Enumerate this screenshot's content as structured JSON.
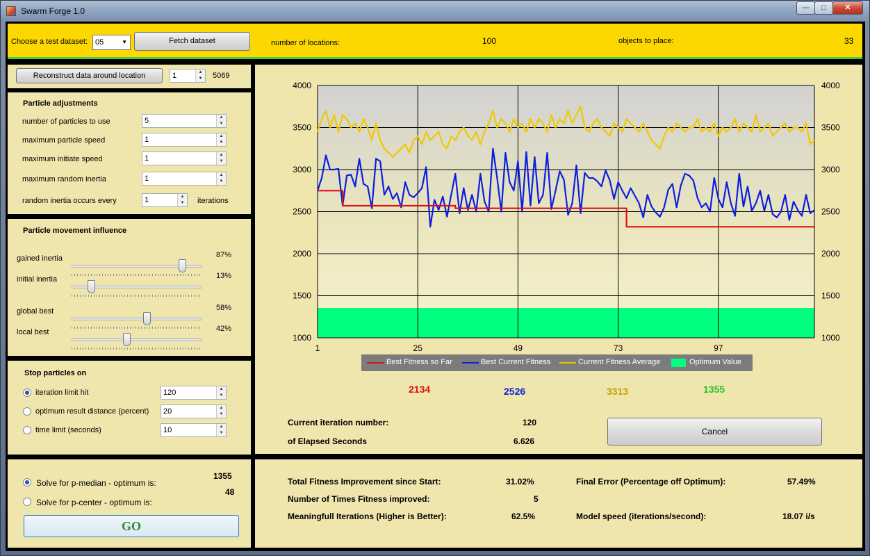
{
  "window": {
    "title": "Swarm Forge 1.0",
    "min": "—",
    "max": "□",
    "close": "✕"
  },
  "top": {
    "dataset_label": "Choose a test dataset:",
    "dataset_value": "05",
    "fetch_label": "Fetch dataset",
    "locations_label": "number of locations:",
    "locations_value": "100",
    "objects_label": "objects to place:",
    "objects_value": "33"
  },
  "reconstruct": {
    "button": "Reconstruct data around location",
    "location_value": "1",
    "count": "5069"
  },
  "particles": {
    "title": "Particle adjustments",
    "fields": [
      {
        "label": "number of particles to use",
        "value": "5"
      },
      {
        "label": "maximum particle speed",
        "value": "1"
      },
      {
        "label": "maximum initiate speed",
        "value": "1"
      },
      {
        "label": "maximum random inertia",
        "value": "1"
      }
    ],
    "random_label": "random inertia occurs every",
    "random_value": "1",
    "random_suffix": "iterations"
  },
  "movement": {
    "title": "Particle movement influence",
    "sliders": [
      {
        "label": "gained inertia",
        "percent": "87%",
        "level": 0.87
      },
      {
        "label": "initial inertia",
        "percent": "13%",
        "level": 0.13
      },
      {
        "label": "global best",
        "percent": "58%",
        "level": 0.58
      },
      {
        "label": "local best",
        "percent": "42%",
        "level": 0.42
      }
    ]
  },
  "stop": {
    "title": "Stop particles on",
    "options": [
      {
        "label": "iteration limit hit",
        "value": "120",
        "selected": true
      },
      {
        "label": "optimum result distance (percent)",
        "value": "20",
        "selected": false
      },
      {
        "label": "time limit (seconds)",
        "value": "10",
        "selected": false
      }
    ]
  },
  "solve": {
    "pmedian_label": "Solve for p-median - optimum is:",
    "pmedian_value": "1355",
    "pcenter_label": "Solve for p-center - optimum is:",
    "pcenter_value": "48",
    "go_label": "GO"
  },
  "legend": {
    "best_so_far": "Best Fitness so Far",
    "best_current": "Best Current Fitness",
    "average": "Current Fitness Average",
    "optimum": "Optimum Value"
  },
  "current": {
    "best_so_far": "2134",
    "best_current": "2526",
    "average": "3313",
    "optimum": "1355"
  },
  "colors": {
    "best_so_far": "#e01010",
    "best_current": "#0a1ee0",
    "average": "#f0c800",
    "optimum": "#00ff7f"
  },
  "progress": {
    "iteration_label": "Current iteration number:",
    "iteration_value": "120",
    "elapsed_label": "of Elapsed Seconds",
    "elapsed_value": "6.626",
    "cancel_label": "Cancel"
  },
  "summary": {
    "improvement_label": "Total Fitness Improvement since Start:",
    "improvement_value": "31.02%",
    "times_label": "Number of Times Fitness improved:",
    "times_value": "5",
    "meaningful_label": "Meaningfull Iterations (Higher is Better):",
    "meaningful_value": "62.5%",
    "error_label": "Final Error (Percentage off Optimum):",
    "error_value": "57.49%",
    "speed_label": "Model speed (iterations/second):",
    "speed_value": "18.07 i/s"
  },
  "chart_data": {
    "type": "line",
    "x_ticks": [
      "1",
      "25",
      "49",
      "73",
      "97"
    ],
    "y_ticks": [
      "1000",
      "1500",
      "2000",
      "2500",
      "3000",
      "3500",
      "4000"
    ],
    "xlim": [
      1,
      120
    ],
    "ylim": [
      1000,
      4000
    ],
    "grid": true,
    "legend_position": "bottom",
    "optimum": 1355,
    "series": [
      {
        "name": "Best Fitness so Far",
        "color": "#e01010",
        "x": [
          1,
          7,
          7,
          34,
          34,
          75,
          75,
          120
        ],
        "values": [
          2750,
          2750,
          2570,
          2570,
          2540,
          2540,
          2320,
          2320
        ]
      },
      {
        "name": "Best Current Fitness",
        "color": "#0a1ee0",
        "values": [
          2750,
          2900,
          3170,
          3000,
          3000,
          3010,
          2570,
          2930,
          2940,
          2800,
          3130,
          2830,
          2800,
          2540,
          3130,
          3100,
          2700,
          2800,
          2650,
          2720,
          2550,
          2850,
          2700,
          2670,
          2720,
          2780,
          3030,
          2320,
          2640,
          2520,
          2680,
          2440,
          2700,
          2950,
          2480,
          2780,
          2520,
          2700,
          2500,
          2950,
          2620,
          2500,
          3250,
          2900,
          2500,
          3200,
          2850,
          2750,
          3100,
          2500,
          3210,
          2570,
          3150,
          2600,
          2700,
          3200,
          2530,
          2750,
          2980,
          2880,
          2460,
          2600,
          3050,
          2480,
          2960,
          2900,
          2900,
          2860,
          2800,
          2990,
          2870,
          2650,
          2850,
          2750,
          2660,
          2780,
          2690,
          2600,
          2430,
          2700,
          2560,
          2490,
          2440,
          2550,
          2760,
          2830,
          2550,
          2810,
          2950,
          2930,
          2870,
          2660,
          2550,
          2600,
          2500,
          2900,
          2650,
          2550,
          2850,
          2600,
          2450,
          2950,
          2560,
          2800,
          2510,
          2600,
          2750,
          2510,
          2700,
          2470,
          2430,
          2500,
          2700,
          2400,
          2620,
          2520,
          2450,
          2700,
          2480,
          2520
        ]
      },
      {
        "name": "Current Fitness Average",
        "color": "#f0c800",
        "values": [
          3450,
          3600,
          3700,
          3500,
          3650,
          3450,
          3650,
          3600,
          3500,
          3550,
          3450,
          3600,
          3500,
          3350,
          3550,
          3350,
          3250,
          3200,
          3150,
          3200,
          3250,
          3300,
          3200,
          3350,
          3400,
          3300,
          3450,
          3350,
          3400,
          3450,
          3300,
          3250,
          3400,
          3350,
          3450,
          3500,
          3400,
          3350,
          3450,
          3300,
          3450,
          3550,
          3700,
          3500,
          3600,
          3550,
          3450,
          3600,
          3500,
          3550,
          3450,
          3600,
          3500,
          3600,
          3550,
          3450,
          3650,
          3500,
          3600,
          3550,
          3700,
          3550,
          3650,
          3750,
          3500,
          3450,
          3550,
          3600,
          3500,
          3450,
          3400,
          3550,
          3500,
          3450,
          3600,
          3550,
          3500,
          3450,
          3550,
          3450,
          3350,
          3300,
          3250,
          3400,
          3500,
          3450,
          3550,
          3500,
          3450,
          3500,
          3500,
          3600,
          3450,
          3500,
          3450,
          3550,
          3400,
          3500,
          3450,
          3500,
          3600,
          3450,
          3550,
          3500,
          3450,
          3650,
          3450,
          3500,
          3550,
          3400,
          3450,
          3500,
          3550,
          3450,
          3500,
          3500,
          3450,
          3550,
          3300,
          3350
        ]
      }
    ]
  }
}
